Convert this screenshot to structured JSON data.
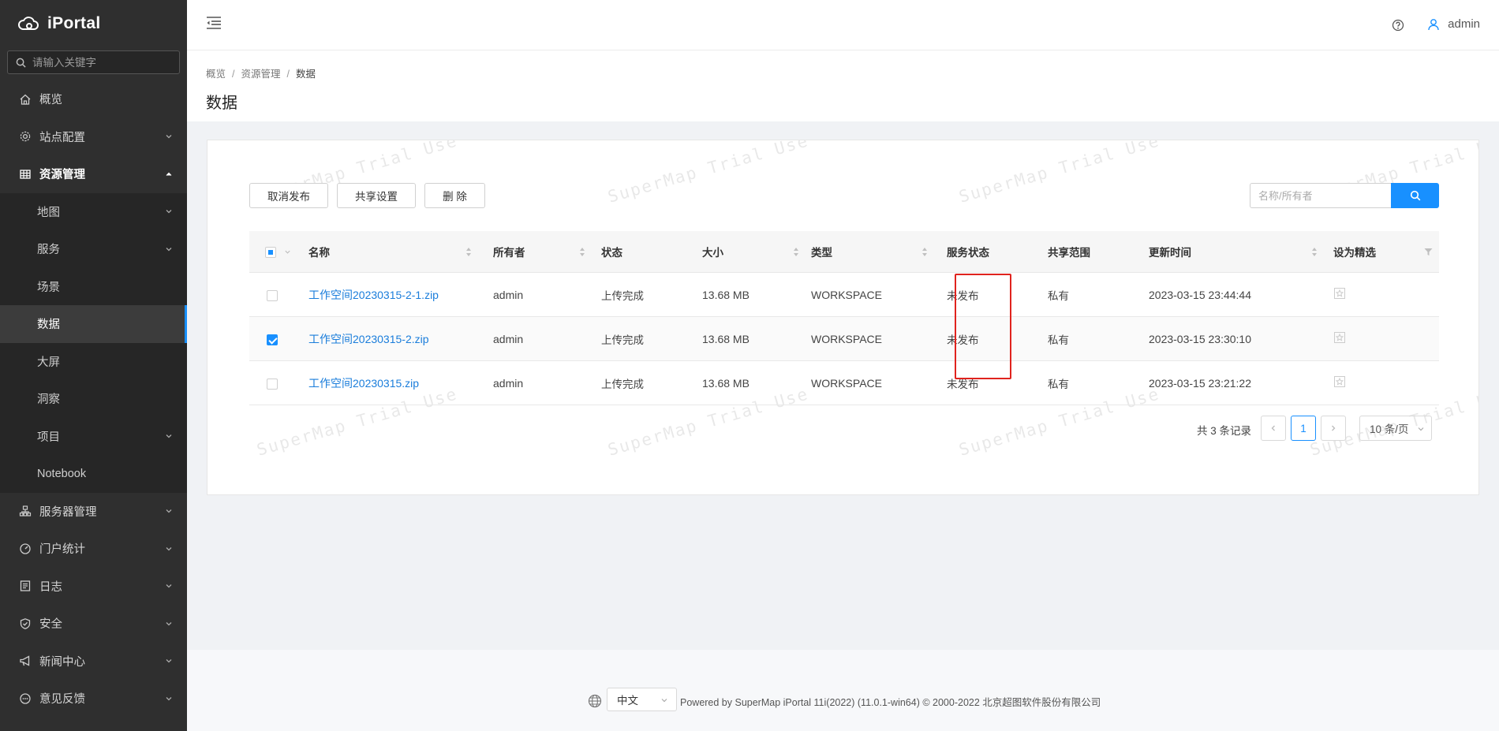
{
  "app": {
    "title": "iPortal"
  },
  "sidebar": {
    "search_placeholder": "请输入关键字",
    "items": [
      {
        "label": "概览",
        "icon": "home-icon"
      },
      {
        "label": "站点配置",
        "icon": "gear-icon"
      },
      {
        "label": "资源管理",
        "icon": "grid-icon",
        "expanded": true
      },
      {
        "label": "服务器管理",
        "icon": "server-icon"
      },
      {
        "label": "门户统计",
        "icon": "dashboard-icon"
      },
      {
        "label": "日志",
        "icon": "log-icon"
      },
      {
        "label": "安全",
        "icon": "shield-icon"
      },
      {
        "label": "新闻中心",
        "icon": "megaphone-icon"
      },
      {
        "label": "意见反馈",
        "icon": "chat-icon"
      }
    ],
    "sub_items": [
      {
        "label": "地图"
      },
      {
        "label": "服务"
      },
      {
        "label": "场景"
      },
      {
        "label": "数据",
        "active": true
      },
      {
        "label": "大屏"
      },
      {
        "label": "洞察"
      },
      {
        "label": "项目"
      },
      {
        "label": "Notebook"
      }
    ]
  },
  "header": {
    "username": "admin"
  },
  "breadcrumb": [
    "概览",
    "资源管理",
    "数据"
  ],
  "page": {
    "title": "数据"
  },
  "toolbar": {
    "unpublish_label": "取消发布",
    "share_label": "共享设置",
    "delete_label": "删 除",
    "search_placeholder": "名称/所有者"
  },
  "table": {
    "headers": [
      "名称",
      "所有者",
      "状态",
      "大小",
      "类型",
      "服务状态",
      "共享范围",
      "更新时间",
      "设为精选"
    ],
    "rows": [
      {
        "checked": false,
        "name": "工作空间20230315-2-1.zip",
        "owner": "admin",
        "status": "上传完成",
        "size": "13.68 MB",
        "type": "WORKSPACE",
        "service_status": "未发布",
        "share": "私有",
        "updated": "2023-03-15 23:44:44"
      },
      {
        "checked": true,
        "name": "工作空间20230315-2.zip",
        "owner": "admin",
        "status": "上传完成",
        "size": "13.68 MB",
        "type": "WORKSPACE",
        "service_status": "未发布",
        "share": "私有",
        "updated": "2023-03-15 23:30:10"
      },
      {
        "checked": false,
        "name": "工作空间20230315.zip",
        "owner": "admin",
        "status": "上传完成",
        "size": "13.68 MB",
        "type": "WORKSPACE",
        "service_status": "未发布",
        "share": "私有",
        "updated": "2023-03-15 23:21:22"
      }
    ]
  },
  "pagination": {
    "total_text": "共 3 条记录",
    "current_page": "1",
    "page_size": "10 条/页"
  },
  "watermark": "SuperMap Trial Use",
  "footer": {
    "language": "中文",
    "powered_by": "Powered by SuperMap iPortal 11i(2022) (11.0.1-win64) © 2000-2022 北京超图软件股份有限公司"
  },
  "colors": {
    "accent": "#1890ff",
    "sidebar_bg": "#2f2f2f",
    "highlight_frame": "#e0231e",
    "link": "#1a7ddb"
  }
}
